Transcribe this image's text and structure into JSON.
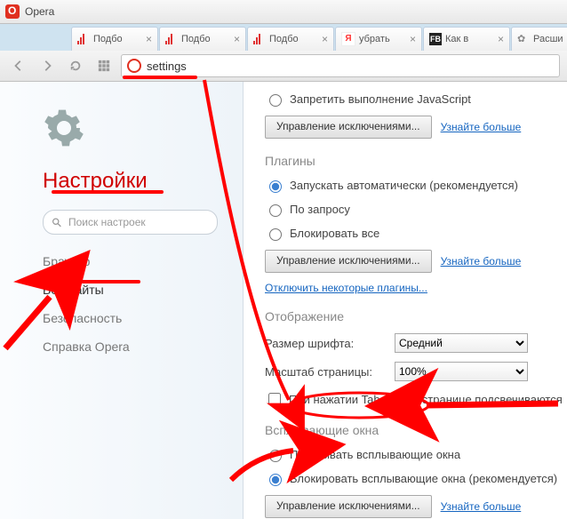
{
  "app": {
    "name": "Opera"
  },
  "tabs": [
    {
      "label": "Подбо",
      "icon": "bars"
    },
    {
      "label": "Подбо",
      "icon": "bars"
    },
    {
      "label": "Подбо",
      "icon": "bars"
    },
    {
      "label": "убрать",
      "icon": "ya"
    },
    {
      "label": "Как в",
      "icon": "fb"
    },
    {
      "label": "Расши",
      "icon": "puzzle"
    }
  ],
  "address": {
    "text": "settings"
  },
  "sidebar": {
    "heading": "Настройки",
    "search_placeholder": "Поиск настроек",
    "items": [
      "Браузер",
      "Веб-сайты",
      "Безопасность",
      "Справка Opera"
    ],
    "active_index": 1
  },
  "content": {
    "js": {
      "deny": "Запретить выполнение JavaScript",
      "manage": "Управление исключениями...",
      "learn": "Узнайте больше"
    },
    "plugins": {
      "heading": "Плагины",
      "auto": "Запускать автоматически (рекомендуется)",
      "ondemand": "По запросу",
      "block": "Блокировать все",
      "manage": "Управление исключениями...",
      "learn": "Узнайте больше",
      "disable": "Отключить некоторые плагины..."
    },
    "display": {
      "heading": "Отображение",
      "font_label": "Размер шрифта:",
      "font_value": "Средний",
      "zoom_label": "Масштаб страницы:",
      "zoom_value": "100%",
      "tab_highlight": "При нажатии Tab на веб-странице подсвечиваются"
    },
    "popups": {
      "heading": "Всплывающие окна",
      "show": "Показывать всплывающие окна",
      "block": "Блокировать всплывающие окна (рекомендуется)",
      "manage": "Управление исключениями...",
      "learn": "Узнайте больше"
    }
  }
}
